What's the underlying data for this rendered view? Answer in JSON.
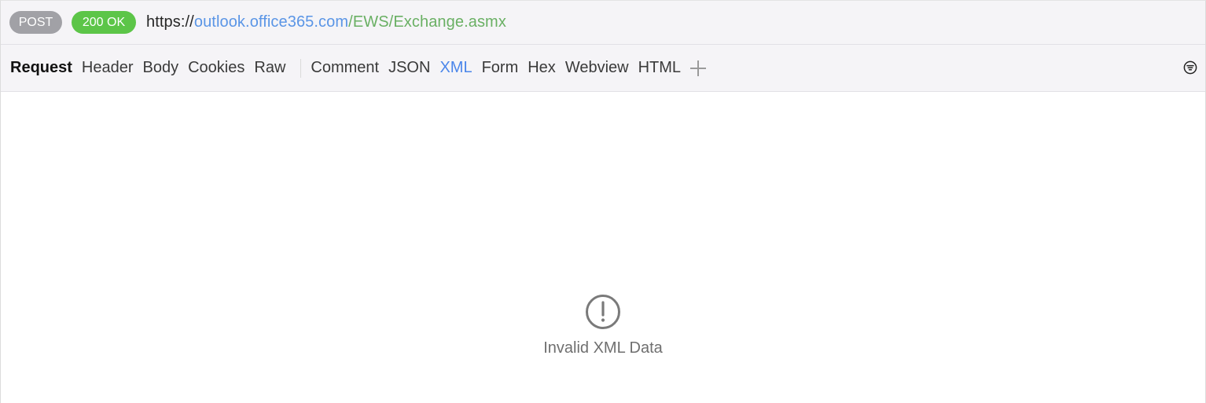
{
  "url_bar": {
    "method": "POST",
    "status": "200 OK",
    "url_scheme": "https://",
    "url_host": "outlook.office365.com",
    "url_path": "/EWS/Exchange.asmx"
  },
  "tabs": {
    "title": "Request",
    "section_tabs": [
      "Header",
      "Body",
      "Cookies",
      "Raw"
    ],
    "view_tabs": [
      "Comment",
      "JSON",
      "XML",
      "Form",
      "Hex",
      "Webview",
      "HTML"
    ],
    "active_view": "XML"
  },
  "content": {
    "message": "Invalid XML Data",
    "icon": "exclamation-circle-icon"
  },
  "colors": {
    "method_badge": "#a1a1a6",
    "status_badge": "#5cc548",
    "url_host": "#5a95e6",
    "url_path": "#6ab064",
    "active_tab": "#4b86ea"
  }
}
